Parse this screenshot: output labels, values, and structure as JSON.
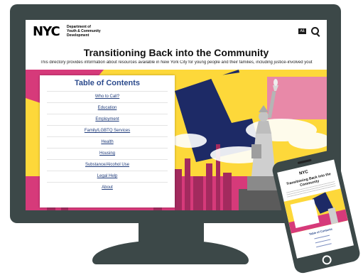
{
  "site": {
    "logo": "NYC",
    "agency_lines": [
      "Department of",
      "Youth & Community",
      "Development"
    ],
    "translate_label": "Aå",
    "search_icon": "search-icon"
  },
  "page": {
    "title": "Transitioning Back into the Community",
    "intro": "This directory provides information about resources available in New York City for young people and their families, including justice-involved yout"
  },
  "toc": {
    "title": "Table of Contents",
    "items": [
      "Who to Call?",
      "Education",
      "Employment",
      "Family/LGBTQ Services",
      "Health",
      "Housing",
      "Substance/Alcohol Use",
      "Legal Help",
      "About"
    ]
  },
  "mobile": {
    "logo": "NYC",
    "title": "Transitioning Back into the Community",
    "toc_title": "Table of Contents"
  },
  "colors": {
    "device_frame": "#3c4848",
    "hero_yellow": "#fdd83a",
    "hero_pink": "#d63a7a",
    "link_blue": "#1f3b7a"
  }
}
